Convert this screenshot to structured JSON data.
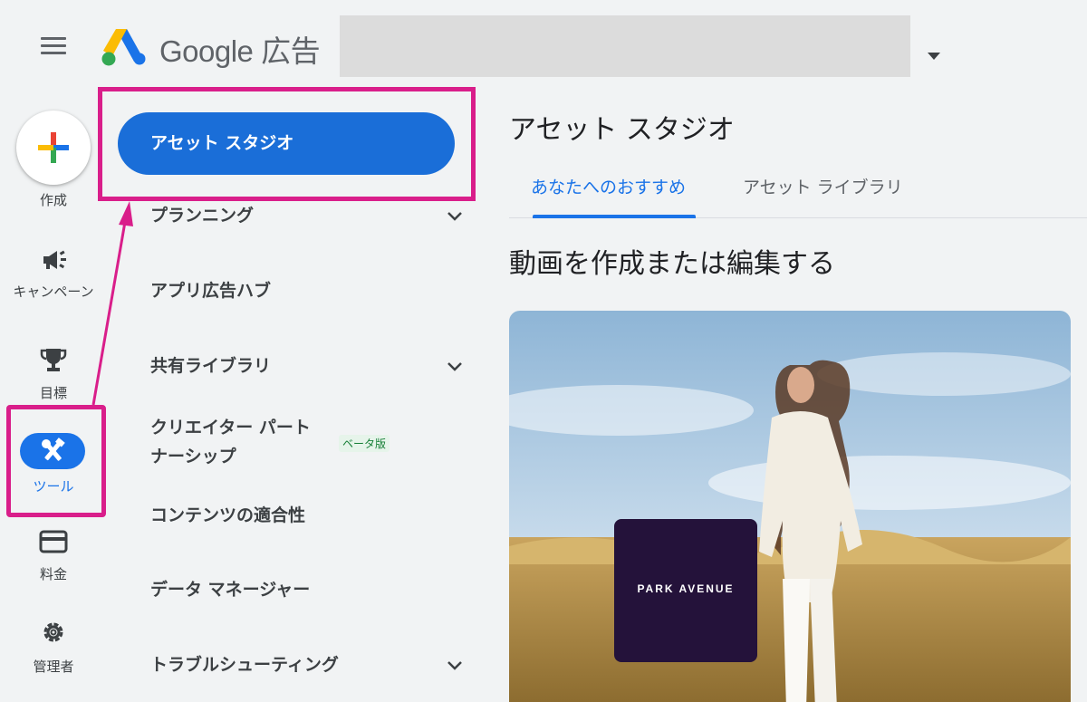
{
  "header": {
    "brand": "Google 広告",
    "menu_icon": "hamburger-menu-icon",
    "logo_icon": "google-ads-logo"
  },
  "rail": {
    "create_label": "作成",
    "items": [
      {
        "label": "キャンペーン",
        "icon": "megaphone-icon"
      },
      {
        "label": "目標",
        "icon": "trophy-icon"
      },
      {
        "label": "ツール",
        "icon": "tools-icon",
        "selected": true
      },
      {
        "label": "料金",
        "icon": "credit-card-icon"
      },
      {
        "label": "管理者",
        "icon": "gear-icon"
      }
    ]
  },
  "subnav": {
    "selected": "アセット スタジオ",
    "items": [
      {
        "label": "プランニング",
        "expandable": true
      },
      {
        "label": "アプリ広告ハブ"
      },
      {
        "label": "共有ライブラリ",
        "expandable": true
      },
      {
        "label": "クリエイター パートナーシップ",
        "badge": "ベータ版"
      },
      {
        "label": "コンテンツの適合性"
      },
      {
        "label": "データ マネージャー"
      },
      {
        "label": "トラブルシューティング",
        "expandable": true
      }
    ],
    "creator_line1": "クリエイター パート",
    "creator_line2": "ナーシップ"
  },
  "main": {
    "title": "アセット スタジオ",
    "tabs": [
      "あなたへのおすすめ",
      "アセット ライブラリ"
    ],
    "active_tab": "あなたへのおすすめ",
    "section_title": "動画を作成または編集する",
    "card_brand": "PARK AVENUE"
  },
  "colors": {
    "accent": "#1a73e8",
    "highlight": "#d91e8a",
    "background": "#f1f3f4"
  }
}
